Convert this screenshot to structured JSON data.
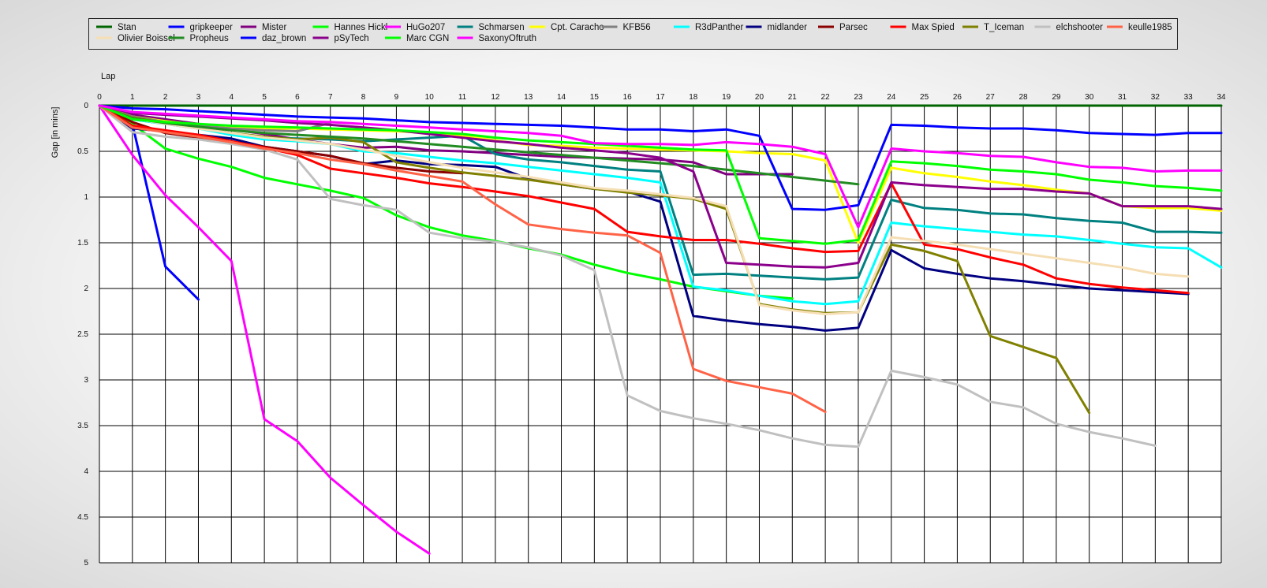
{
  "chart_data": {
    "type": "line",
    "xlabel": "Lap",
    "ylabel": "Gap [in mins]",
    "xlim": [
      0,
      34
    ],
    "ylim": [
      0,
      5
    ],
    "y_inverted": true,
    "grid": true,
    "legend_position": "top",
    "x_ticks": [
      "0",
      "1",
      "2",
      "3",
      "4",
      "5",
      "6",
      "7",
      "8",
      "9",
      "10",
      "11",
      "12",
      "13",
      "14",
      "15",
      "16",
      "17",
      "18",
      "19",
      "20",
      "21",
      "22",
      "23",
      "24",
      "25",
      "26",
      "27",
      "28",
      "29",
      "30",
      "31",
      "32",
      "33",
      "34"
    ],
    "y_ticks": [
      "0",
      "0.5",
      "1",
      "1.5",
      "2",
      "2.5",
      "3",
      "3.5",
      "4",
      "4.5",
      "5"
    ],
    "series": [
      {
        "name": "Stan",
        "color": "#006400",
        "values": [
          0,
          0,
          0,
          0,
          0,
          0,
          0,
          0,
          0,
          0,
          0,
          0,
          0,
          0,
          0,
          0,
          0,
          0,
          0,
          0,
          0,
          0,
          0,
          0,
          0,
          0,
          0,
          0,
          0,
          0,
          0,
          0,
          0,
          0,
          0
        ]
      },
      {
        "name": "gripkeeper",
        "color": "#0000FF",
        "values": [
          0,
          0.2,
          1.76,
          2.12
        ]
      },
      {
        "name": "Mister",
        "color": "#800080",
        "values": [
          0,
          0.1,
          0.15,
          0.2,
          0.26,
          0.31,
          0.37,
          0.42,
          0.46,
          0.45,
          0.49,
          0.5,
          0.52,
          0.54,
          0.56,
          0.57,
          0.58,
          0.59,
          0.62,
          0.75,
          0.75,
          0.75
        ]
      },
      {
        "name": "Hannes Hickl",
        "color": "#00FF00",
        "values": [
          0,
          0.2,
          0.47,
          0.58,
          0.67,
          0.79,
          0.86,
          0.93,
          1.01,
          1.2,
          1.33,
          1.42,
          1.48,
          1.56,
          1.63,
          1.74,
          1.83,
          1.9,
          1.98,
          2.03,
          2.08,
          2.11
        ]
      },
      {
        "name": "HuGo207",
        "color": "#FF00FF",
        "values": [
          0,
          0.54,
          0.98,
          1.33,
          1.7,
          3.43,
          3.67,
          4.07,
          4.37,
          4.66,
          4.9
        ]
      },
      {
        "name": "Schmarsen",
        "color": "#008080",
        "values": [
          0,
          0.15,
          0.2,
          0.25,
          0.3,
          0.35,
          0.36,
          0.37,
          0.39,
          0.37,
          0.35,
          0.33,
          0.53,
          0.59,
          0.62,
          0.66,
          0.7,
          0.72,
          1.85,
          1.84,
          1.86,
          1.88,
          1.9,
          1.88,
          1.03,
          1.12,
          1.14,
          1.18,
          1.19,
          1.23,
          1.26,
          1.28,
          1.38,
          1.38,
          1.39
        ]
      },
      {
        "name": "Cpt. Caracho",
        "color": "#FFFF00",
        "values": [
          0,
          0.12,
          0.17,
          0.21,
          0.24,
          0.25,
          0.25,
          0.26,
          0.27,
          0.28,
          0.3,
          0.33,
          0.38,
          0.43,
          0.44,
          0.46,
          0.47,
          0.48,
          0.49,
          0.5,
          0.52,
          0.53,
          0.6,
          1.5,
          0.68,
          0.74,
          0.78,
          0.83,
          0.87,
          0.92,
          0.96,
          1.1,
          1.12,
          1.12,
          1.15
        ]
      },
      {
        "name": "KFB56",
        "color": "#808080",
        "values": [
          0,
          0.12,
          0.18,
          0.22,
          0.25,
          0.27,
          0.28,
          0.19
        ]
      },
      {
        "name": "R3dPanther",
        "color": "#00FFFF",
        "values": [
          0,
          0.15,
          0.2,
          0.25,
          0.32,
          0.37,
          0.39,
          0.42,
          0.5,
          0.52,
          0.56,
          0.6,
          0.63,
          0.67,
          0.71,
          0.75,
          0.79,
          0.84,
          1.98,
          2.02,
          2.08,
          2.14,
          2.17,
          2.14,
          1.28,
          1.32,
          1.35,
          1.38,
          1.41,
          1.43,
          1.47,
          1.51,
          1.55,
          1.56,
          1.77
        ]
      },
      {
        "name": "midlander",
        "color": "#000080",
        "values": [
          0,
          0.25,
          0.28,
          0.32,
          0.36,
          0.45,
          0.5,
          0.55,
          0.64,
          0.6,
          0.64,
          0.65,
          0.67,
          0.8,
          0.86,
          0.91,
          0.94,
          1.05,
          2.3,
          2.35,
          2.39,
          2.42,
          2.46,
          2.43,
          1.58,
          1.78,
          1.84,
          1.89,
          1.92,
          1.96,
          2,
          2.02,
          2.04,
          2.06
        ]
      },
      {
        "name": "Parsec",
        "color": "#8B0000",
        "values": [
          0,
          0.18,
          0.3,
          0.35,
          0.4,
          0.45,
          0.5,
          0.55,
          0.63,
          0.68,
          0.72,
          0.74
        ]
      },
      {
        "name": "Max Spied",
        "color": "#FF0000",
        "values": [
          0,
          0.22,
          0.27,
          0.32,
          0.39,
          0.46,
          0.54,
          0.69,
          0.74,
          0.79,
          0.85,
          0.89,
          0.94,
          0.99,
          1.06,
          1.13,
          1.38,
          1.43,
          1.47,
          1.47,
          1.51,
          1.56,
          1.6,
          1.59,
          0.85,
          1.52,
          1.57,
          1.66,
          1.74,
          1.89,
          1.95,
          1.99,
          2.02,
          2.05
        ]
      },
      {
        "name": "T_Iceman",
        "color": "#808000",
        "values": [
          0,
          0.13,
          0.19,
          0.24,
          0.3,
          0.34,
          0.37,
          0.35,
          0.4,
          0.62,
          0.68,
          0.73,
          0.77,
          0.81,
          0.86,
          0.91,
          0.95,
          0.98,
          1.02,
          1.13,
          2.17,
          2.23,
          2.27,
          2.26,
          1.52,
          1.59,
          1.7,
          2.52,
          2.64,
          2.76,
          3.36
        ]
      },
      {
        "name": "elchshooter",
        "color": "#C0C0C0",
        "values": [
          0,
          0.29,
          0.34,
          0.37,
          0.42,
          0.48,
          0.59,
          1.02,
          1.09,
          1.14,
          1.39,
          1.45,
          1.49,
          1.55,
          1.64,
          1.8,
          3.17,
          3.34,
          3.42,
          3.48,
          3.55,
          3.64,
          3.71,
          3.73,
          2.9,
          2.97,
          3.05,
          3.24,
          3.3,
          3.48,
          3.57,
          3.64,
          3.72
        ]
      },
      {
        "name": "keulle1985",
        "color": "#FF6347",
        "values": [
          0,
          0.24,
          0.29,
          0.34,
          0.4,
          0.47,
          0.52,
          0.59,
          0.64,
          0.71,
          0.77,
          0.83,
          1.08,
          1.3,
          1.35,
          1.39,
          1.42,
          1.61,
          2.88,
          3.01,
          3.08,
          3.15,
          3.35
        ]
      },
      {
        "name": "Olivier Boissel",
        "color": "#F5DEB3",
        "values": [
          0,
          0.14,
          0.2,
          0.25,
          0.3,
          0.35,
          0.38,
          0.42,
          0.48,
          0.55,
          0.62,
          0.68,
          0.73,
          0.78,
          0.84,
          0.9,
          0.93,
          0.97,
          1.01,
          1.1,
          2.18,
          2.24,
          2.28,
          2.26,
          1.44,
          1.48,
          1.52,
          1.57,
          1.62,
          1.67,
          1.72,
          1.77,
          1.84,
          1.87
        ]
      },
      {
        "name": "Propheus",
        "color": "#228B22",
        "values": [
          0,
          0.14,
          0.19,
          0.23,
          0.27,
          0.3,
          0.32,
          0.34,
          0.36,
          0.39,
          0.42,
          0.45,
          0.48,
          0.51,
          0.54,
          0.57,
          0.6,
          0.63,
          0.66,
          0.7,
          0.74,
          0.78,
          0.82,
          0.86
        ]
      },
      {
        "name": "daz_brown",
        "color": "#0000FF",
        "values": [
          0,
          0.03,
          0.04,
          0.06,
          0.08,
          0.1,
          0.12,
          0.13,
          0.14,
          0.16,
          0.18,
          0.19,
          0.2,
          0.21,
          0.22,
          0.24,
          0.26,
          0.26,
          0.28,
          0.26,
          0.33,
          1.13,
          1.14,
          1.09,
          0.21,
          0.22,
          0.24,
          0.25,
          0.25,
          0.27,
          0.3,
          0.31,
          0.32,
          0.3,
          0.3
        ]
      },
      {
        "name": "pSyTech",
        "color": "#8B008B",
        "values": [
          0,
          0.08,
          0.1,
          0.12,
          0.14,
          0.16,
          0.19,
          0.21,
          0.24,
          0.27,
          0.31,
          0.35,
          0.39,
          0.42,
          0.46,
          0.49,
          0.52,
          0.57,
          0.72,
          1.72,
          1.74,
          1.76,
          1.77,
          1.72,
          0.84,
          0.87,
          0.89,
          0.91,
          0.91,
          0.94,
          0.96,
          1.1,
          1.1,
          1.1,
          1.13
        ]
      },
      {
        "name": "Marc CGN",
        "color": "#00FF00",
        "values": [
          0,
          0.15,
          0.18,
          0.2,
          0.22,
          0.23,
          0.24,
          0.25,
          0.26,
          0.27,
          0.29,
          0.31,
          0.35,
          0.38,
          0.4,
          0.42,
          0.44,
          0.46,
          0.48,
          0.49,
          1.45,
          1.48,
          1.51,
          1.47,
          0.61,
          0.63,
          0.66,
          0.7,
          0.72,
          0.75,
          0.81,
          0.84,
          0.88,
          0.9,
          0.93
        ]
      },
      {
        "name": "SaxonyOftruth",
        "color": "#FF00FF",
        "values": [
          0,
          0.07,
          0.09,
          0.11,
          0.13,
          0.15,
          0.17,
          0.18,
          0.2,
          0.22,
          0.24,
          0.26,
          0.28,
          0.3,
          0.33,
          0.41,
          0.42,
          0.42,
          0.43,
          0.4,
          0.42,
          0.45,
          0.53,
          1.33,
          0.47,
          0.5,
          0.52,
          0.55,
          0.56,
          0.62,
          0.67,
          0.68,
          0.72,
          0.71,
          0.71
        ]
      }
    ]
  }
}
